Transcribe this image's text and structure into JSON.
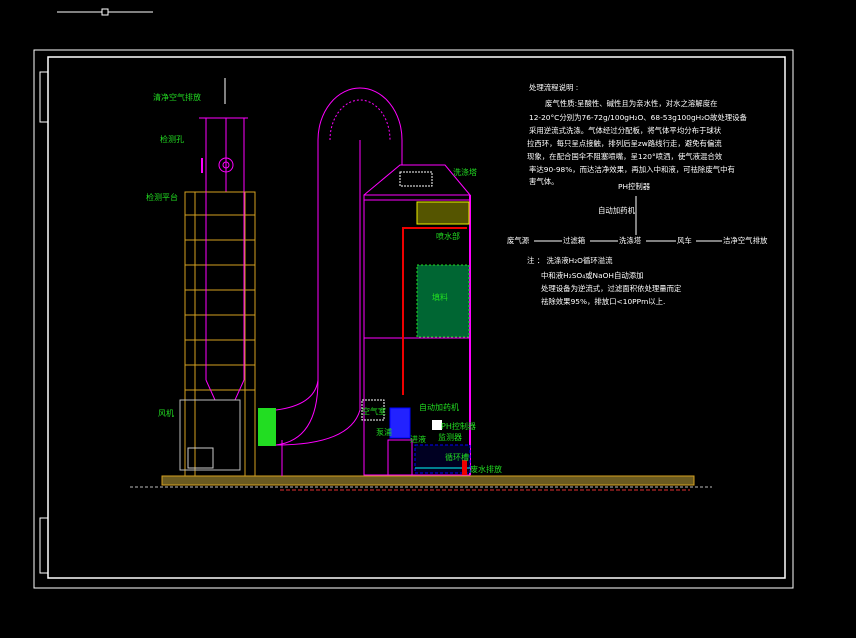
{
  "labels": {
    "clean_air": "清净空气排放",
    "inspection_hole": "检测孔",
    "platform": "检测平台",
    "fan": "风机",
    "scrubber": "洗涤塔",
    "spray": "喷水部",
    "packing": "填料",
    "air_chamber": "空气室",
    "pump": "泵浦",
    "auto_dosing": "自动加药机",
    "ph_controller": "PH控制器",
    "monitor": "监测器",
    "inlet": "进液",
    "tank": "循环槽",
    "wastewater": "废水排放"
  },
  "description": {
    "title": "处理流程说明 :",
    "lines": [
      "废气性质:呈酸性、碱性且为亲水性，对水之溶解度在",
      "12-20°C分别为76-72g/100gH₂O、68-53g100gH₂O故处理设备",
      "采用逆流式洗涤。气体经过分配板，将气体平均分布于球状",
      "拉西环，每只呈点接触，排列后呈zw路线行走，避免有偏流",
      "现象，在配合国伞不阻塞喷嘴，呈120°喷洒，使气液混合效",
      "率达90-98%，而达洁净效果，再加入中和液，可祛除废气中有",
      "害气体。"
    ]
  },
  "flow": {
    "ph": "PH控制器",
    "dosing": "自动加药机",
    "steps": [
      "废气源",
      "过滤箱",
      "洗涤塔",
      "风车",
      "洁净空气排放"
    ]
  },
  "notes": [
    "注 ：  洗涤液H₂O循环溢流",
    "中和液H₂SO₄或NaOH自动添加",
    "处理设备为逆流式，过滤面积依处理量而定",
    "祛除效果95%，排放口<10PPm以上."
  ]
}
